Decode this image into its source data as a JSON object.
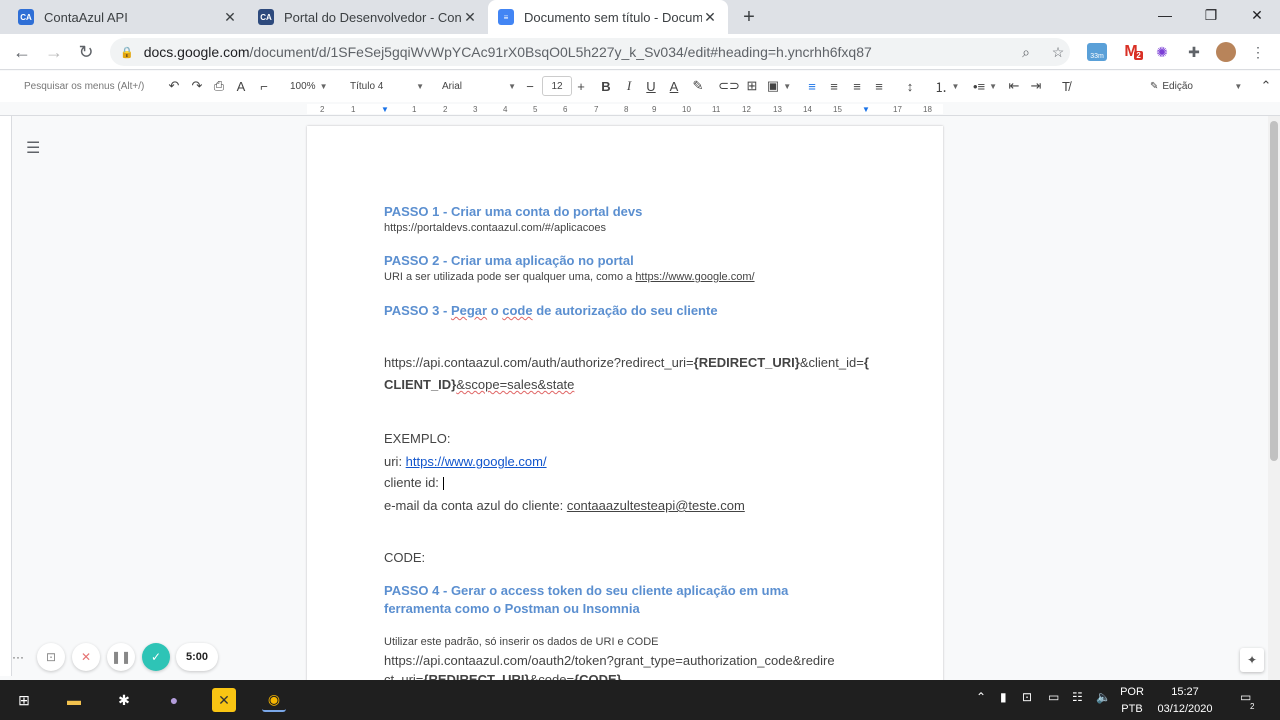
{
  "tabs": [
    {
      "title": "ContaAzul API",
      "icon": "CA",
      "color": "#2f6fd6"
    },
    {
      "title": "Portal do Desenvolvedor - Conta",
      "icon": "CA",
      "color": "#2e4a7d"
    },
    {
      "title": "Documento sem título - Docume",
      "icon": "docs-icon",
      "color": "#4285f4"
    }
  ],
  "address": {
    "host": "docs.google.com",
    "path": "/document/d/1SFeSej5gqiWvWpYCAc91rX0BsqO0L5h227y_k_Sv034/edit#heading=h.yncrhh6fxq87"
  },
  "extensions": {
    "timer_badge": "33m",
    "gmail_badge": "2"
  },
  "toolbar": {
    "search_placeholder": "Pesquisar os menus (Alt+/)",
    "zoom": "100%",
    "style": "Título 4",
    "font": "Arial",
    "size": "12",
    "mode": "Edição"
  },
  "ruler_ticks": [
    "2",
    "1",
    "1",
    "2",
    "3",
    "4",
    "5",
    "6",
    "7",
    "8",
    "9",
    "10",
    "11",
    "12",
    "13",
    "14",
    "15",
    "16",
    "17",
    "18"
  ],
  "doc": {
    "step1_title": "PASSO 1 - Criar uma conta do portal devs",
    "step1_url": "https://portaldevs.contaazul.com/#/aplicacoes",
    "step2_title": "PASSO 2 - Criar uma aplicação no portal",
    "step2_text": "URI a ser utilizada pode ser qualquer uma, como a ",
    "step2_link": "https://www.google.com/",
    "step3_title_a": "PASSO 3 - ",
    "step3_title_b": "Pegar",
    "step3_title_c": " o ",
    "step3_title_d": "code",
    "step3_title_e": " de autorização do seu cliente",
    "auth_url_1a": "https://api.contaazul.com/auth/authorize?redirect_uri=",
    "auth_url_1b": "{REDIRECT_URI}",
    "auth_url_1c": "&client_id=",
    "auth_url_1d": "{",
    "auth_url_2a": "CLIENT_ID}",
    "auth_url_2b": "&scope=sales&state",
    "example_label": "EXEMPLO:",
    "uri_label": "uri: ",
    "uri_link": "https://www.google.com/",
    "client_id_label": "cliente id: ",
    "email_label": "e-mail da conta azul do cliente: ",
    "email_value": "contaaazultesteapi@teste.com",
    "code_label": "CODE:",
    "step4_title_1": "PASSO 4 - Gerar o access token do seu cliente aplicação em uma",
    "step4_title_2": "ferramenta como o Postman ou Insomnia",
    "step4_text": "Utilizar este padrão, só inserir os dados de URI e CODE",
    "token_url_1": "https://api.contaazul.com/oauth2/token?grant_type=authorization_code&redire",
    "token_url_2a": "ct_uri=",
    "token_url_2b": "{REDIRECT_URI}",
    "token_url_2c": "&code=",
    "token_url_2d": "{CODE}"
  },
  "recorder": {
    "timer": "5:00"
  },
  "taskbar": {
    "lang1": "POR",
    "lang2": "PTB",
    "time": "15:27",
    "date": "03/12/2020",
    "notif": "2"
  }
}
